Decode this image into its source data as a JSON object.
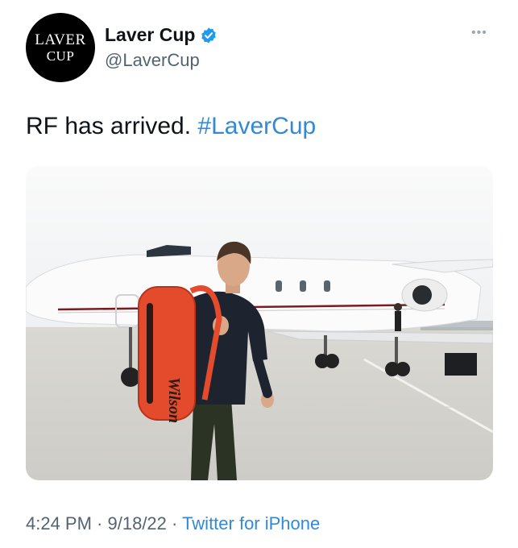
{
  "account": {
    "avatar_line1": "LAVER",
    "avatar_line2": "CUP",
    "display_name": "Laver Cup",
    "handle": "@LaverCup",
    "verified": true,
    "verified_icon": "verified-badge-icon",
    "more_icon": "more-options-icon"
  },
  "tweet": {
    "text": "RF has arrived.",
    "hashtag": "#LaverCup"
  },
  "media": {
    "bag_brand": "Wilson"
  },
  "meta": {
    "time": "4:24 PM",
    "sep1": " · ",
    "date": "9/18/22",
    "sep2": " · ",
    "source": "Twitter for iPhone"
  },
  "colors": {
    "link": "#3289d6",
    "secondary_text": "#536471",
    "verified": "#1d9bf0"
  }
}
